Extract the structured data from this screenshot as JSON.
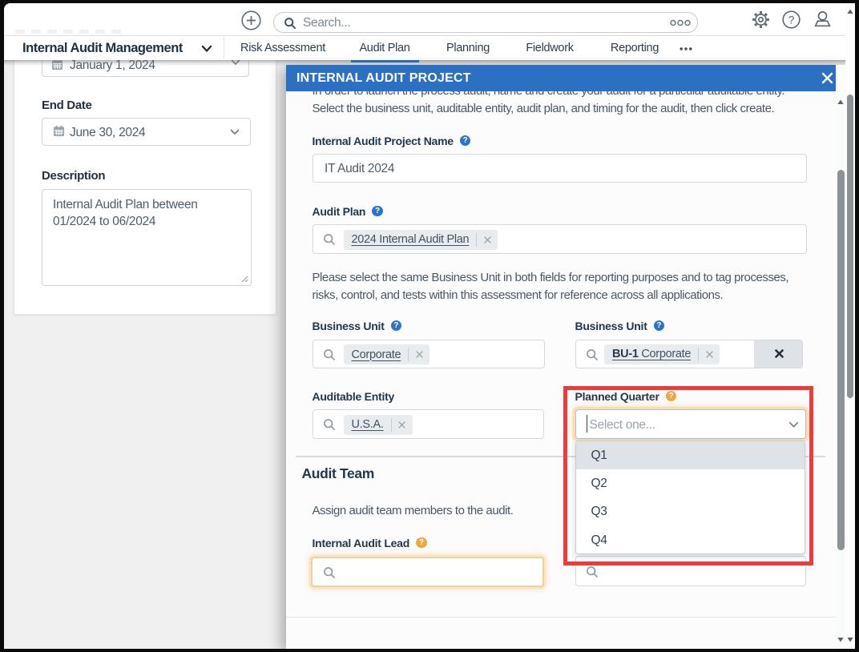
{
  "topbar": {
    "search_placeholder": "Search...",
    "icons": {
      "add": "plus-circle",
      "search": "magnifier",
      "more_options": "ellipsis-circles",
      "settings": "gear",
      "help": "question-circle",
      "account": "person"
    }
  },
  "nav": {
    "title": "Internal Audit Management",
    "tabs": [
      {
        "label": "Risk Assessment",
        "active": false
      },
      {
        "label": "Audit Plan",
        "active": true
      },
      {
        "label": "Planning",
        "active": false
      },
      {
        "label": "Fieldwork",
        "active": false
      },
      {
        "label": "Reporting",
        "active": false
      }
    ],
    "more_tab_icon": "ellipsis",
    "active_tab_color": "#2b71b8"
  },
  "form_panel": {
    "start_date": {
      "value": "January 1, 2024"
    },
    "end_date": {
      "label": "End Date",
      "value": "June 30, 2024"
    },
    "description": {
      "label": "Description",
      "value": "Internal Audit Plan between 01/2024 to 06/2024"
    }
  },
  "modal": {
    "title": "INTERNAL AUDIT PROJECT",
    "header_color": "#2c70c4",
    "intro_lines": [
      "In order to launch the process audit, name and create your audit for a particular auditable entity.",
      "Select the business unit, auditable entity, audit plan, and timing for the audit, then click create."
    ],
    "project_name": {
      "label": "Internal Audit Project Name",
      "value": "IT Audit 2024"
    },
    "audit_plan": {
      "label": "Audit Plan",
      "tag": "2024 Internal Audit Plan"
    },
    "note_lines": [
      "Please select the same Business Unit in both fields for reporting purposes and to tag processes,",
      "risks, control, and tests within this assessment for reference across all applications."
    ],
    "business_unit_left": {
      "label": "Business Unit",
      "tag": "Corporate"
    },
    "business_unit_right": {
      "label": "Business Unit",
      "tag_prefix": "BU-1",
      "tag": "Corporate"
    },
    "auditable_entity": {
      "label": "Auditable Entity",
      "tag": "U.S.A."
    },
    "planned_quarter": {
      "label": "Planned Quarter",
      "placeholder": "Select one...",
      "options": [
        "Q1",
        "Q2",
        "Q3",
        "Q4"
      ],
      "highlighted_option": "Q1",
      "annotation_color": "#ee3b3c"
    },
    "audit_team": {
      "heading": "Audit Team",
      "description": "Assign audit team members to the audit.",
      "lead_label": "Internal Audit Lead"
    }
  }
}
